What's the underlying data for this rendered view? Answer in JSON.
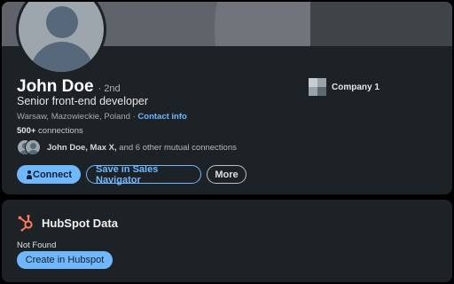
{
  "profile": {
    "name": "John Doe",
    "degree": "· 2nd",
    "headline": "Senior front-end developer",
    "location": "Warsaw, Mazowieckie, Poland",
    "location_separator": " · ",
    "contact_info_label": "Contact info",
    "connections_count": "500+",
    "connections_label": " connections",
    "mutual": {
      "names": "John Doe, Max X,",
      "rest": " and 6 other mutual connections"
    },
    "company": "Company 1"
  },
  "actions": {
    "connect_label": "Connect",
    "sales_navigator_label": "Save in Sales Navigator",
    "more_label": "More"
  },
  "hubspot": {
    "title": "HubSpot Data",
    "status": "Not Found",
    "create_label": "Create in Hubspot"
  },
  "colors": {
    "accent": "#71b7fb",
    "card_bg": "#1d2226",
    "hubspot_orange": "#ff7a59"
  }
}
